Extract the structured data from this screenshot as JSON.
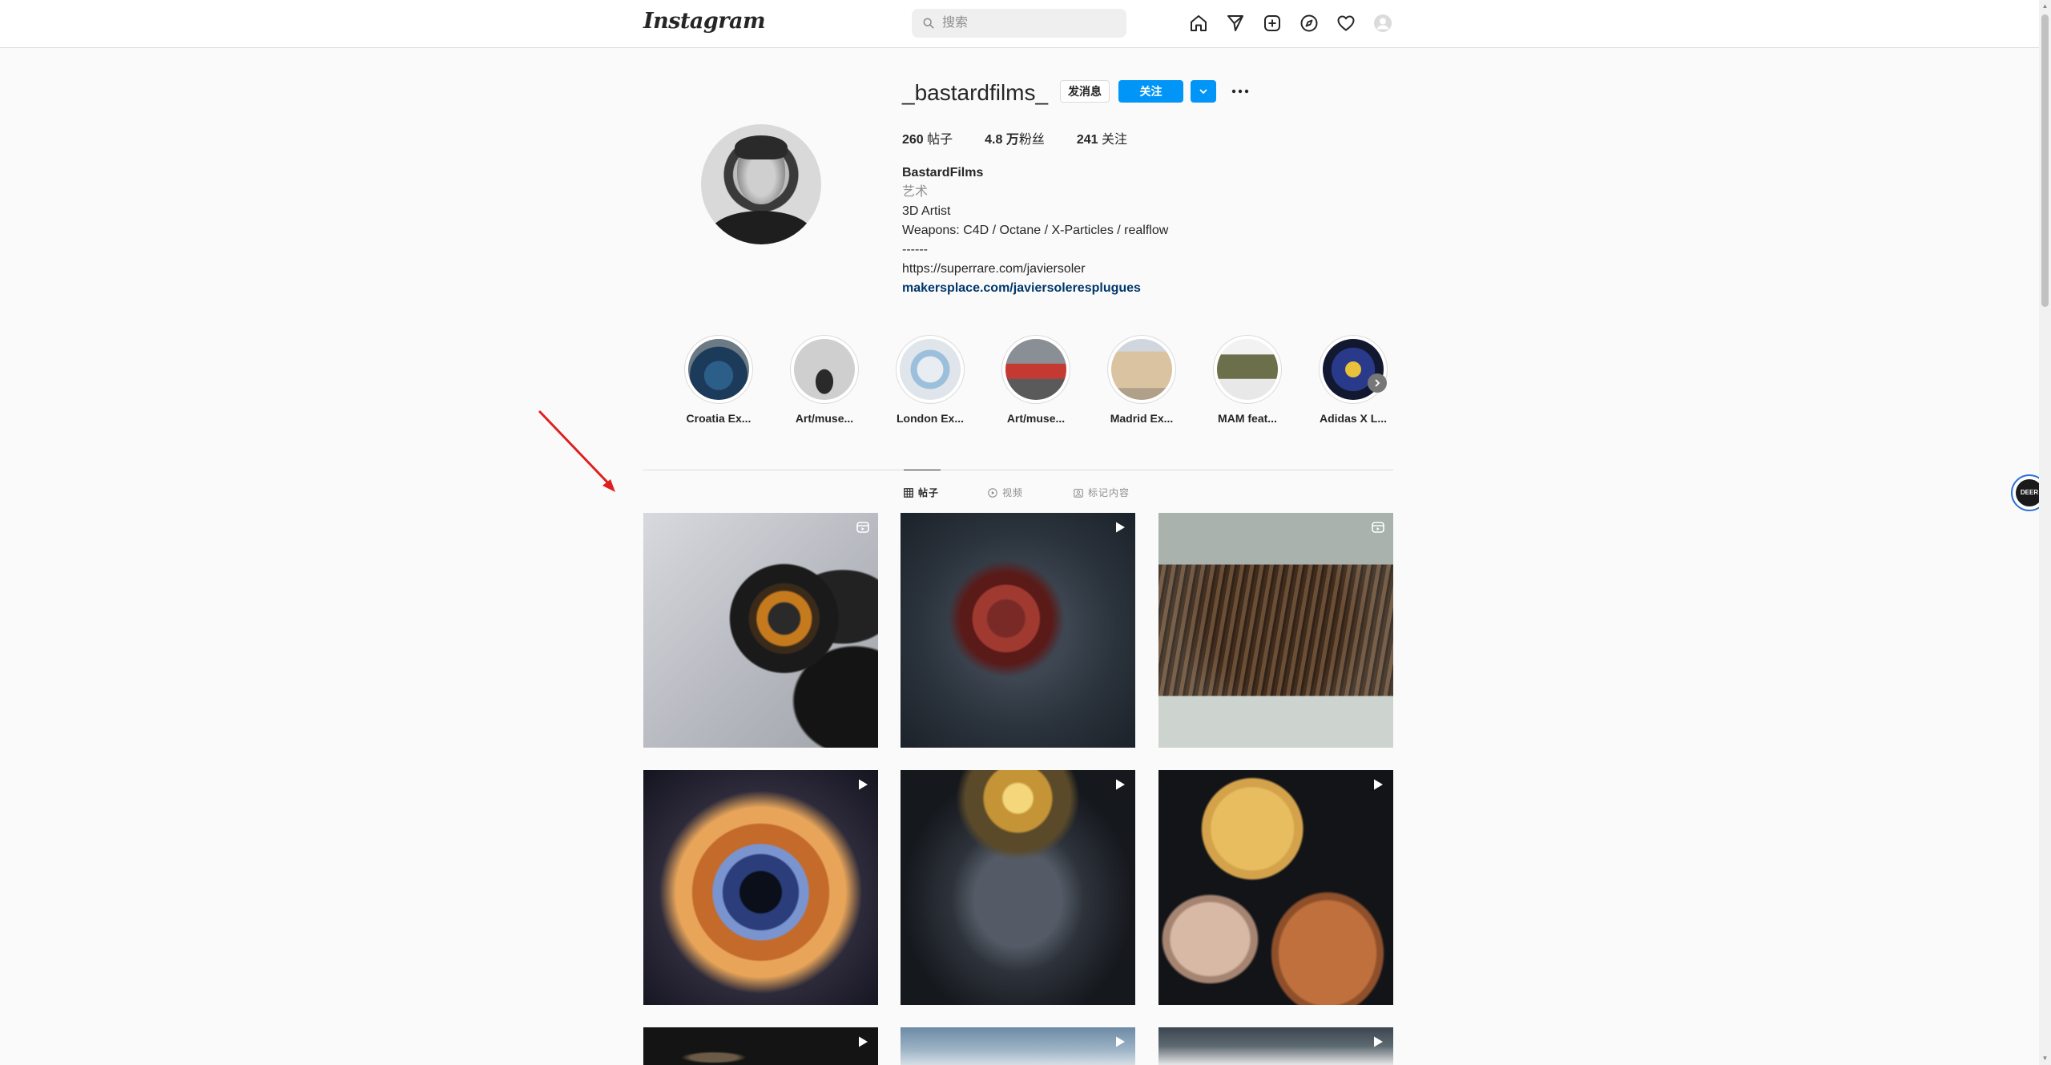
{
  "nav": {
    "logo": "Instagram",
    "search_placeholder": "搜索"
  },
  "profile": {
    "username": "_bastardfilms_",
    "message_button": "发消息",
    "follow_button": "关注",
    "stats": {
      "posts_count": "260",
      "posts_label": " 帖子",
      "followers_count": "4.8 万",
      "followers_label": "粉丝",
      "following_count": "241",
      "following_label": " 关注"
    },
    "bio": {
      "name": "BastardFilms",
      "category": "艺术",
      "lines": [
        "3D Artist",
        "Weapons: C4D / Octane / X-Particles / realflow",
        "------",
        "https://superrare.com/javiersoler"
      ],
      "link": "makersplace.com/javiersoleresplugues"
    }
  },
  "highlights": [
    {
      "label": "Croatia Ex..."
    },
    {
      "label": "Art/muse..."
    },
    {
      "label": "London Ex..."
    },
    {
      "label": "Art/muse..."
    },
    {
      "label": "Madrid Ex..."
    },
    {
      "label": "MAM feat..."
    },
    {
      "label": "Adidas X L..."
    }
  ],
  "tabs": [
    {
      "label": "帖子",
      "icon": "grid-icon",
      "active": true
    },
    {
      "label": "视频",
      "icon": "play-circle-icon",
      "active": false
    },
    {
      "label": "标记内容",
      "icon": "tag-icon",
      "active": false
    }
  ],
  "posts": [
    {
      "badge": "reel-icon"
    },
    {
      "badge": "video-play-icon"
    },
    {
      "badge": "reel-icon"
    },
    {
      "badge": "video-play-icon"
    },
    {
      "badge": "video-play-icon"
    },
    {
      "badge": "video-play-icon"
    },
    {
      "badge": "video-play-icon"
    },
    {
      "badge": "video-play-icon"
    },
    {
      "badge": "video-play-icon"
    }
  ],
  "side_widget": {
    "text": "DEER"
  },
  "colors": {
    "accent": "#0095f6",
    "link": "#00376b",
    "annotation_arrow": "#e02020"
  }
}
